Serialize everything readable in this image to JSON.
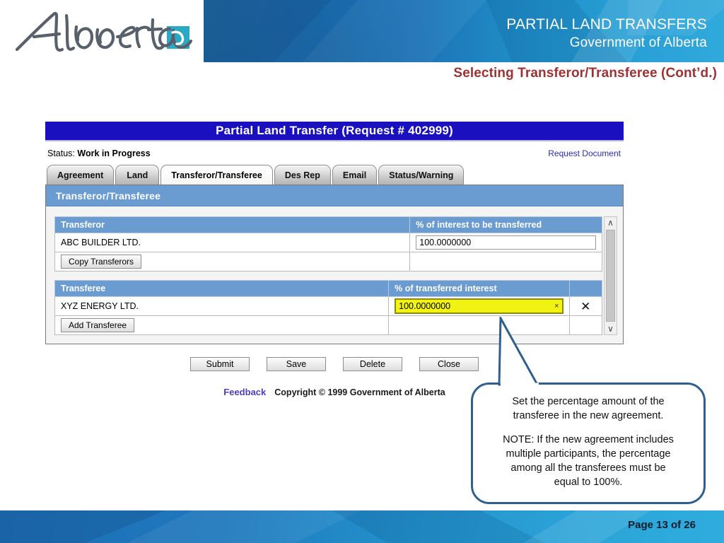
{
  "header": {
    "logo_text": "Alberta",
    "banner_title": "PARTIAL LAND TRANSFERS",
    "banner_subtitle": "Government of Alberta",
    "slide_subtitle": "Selecting Transferor/Transferee (Cont’d.)",
    "accent_blue": "#1f8ac4",
    "logo_square_color": "#2aa8c4",
    "subtitle_color": "#9e3232"
  },
  "app": {
    "title": "Partial Land Transfer (Request # 402999)",
    "titlebar_color": "#1a10bf",
    "status_prefix": "Status:",
    "status_value": "Work in Progress",
    "request_document_link": "Request Document",
    "tabs": [
      {
        "label": "Agreement",
        "active": false
      },
      {
        "label": "Land",
        "active": false
      },
      {
        "label": "Transferor/Transferee",
        "active": true
      },
      {
        "label": "Des Rep",
        "active": false
      },
      {
        "label": "Email",
        "active": false
      },
      {
        "label": "Status/Warning",
        "active": false
      }
    ],
    "panel_title": "Transferor/Transferee",
    "panel_header_color": "#6a9bd1",
    "transferor": {
      "col_name": "Transferor",
      "col_pct": "% of interest to be transferred",
      "row_name": "ABC BUILDER LTD.",
      "row_pct": "100.0000000",
      "button": "Copy Transferors"
    },
    "transferee": {
      "col_name": "Transferee",
      "col_pct": "% of transferred interest",
      "row_name": "XYZ ENERGY LTD.",
      "row_pct": "100.0000000",
      "clear_glyph": "×",
      "delete_glyph": "✕",
      "button": "Add Transferee",
      "highlight_color": "#f2f312"
    },
    "scroll_up_glyph": "∧",
    "scroll_down_glyph": "∨",
    "buttons": [
      "Submit",
      "Save",
      "Delete",
      "Close"
    ],
    "feedback_link": "Feedback",
    "copyright": "Copyright © 1999 Government of Alberta"
  },
  "callout": {
    "line1": "Set the percentage amount of the",
    "line2": "transferee in the new agreement.",
    "line3": "NOTE: If the new agreement includes",
    "line4": "multiple participants, the percentage",
    "line5": "among all the transferees must be",
    "line6": "equal to 100%.",
    "border_color": "#2e5f8f"
  },
  "footer": {
    "page_label": "Page 13 of 26"
  }
}
